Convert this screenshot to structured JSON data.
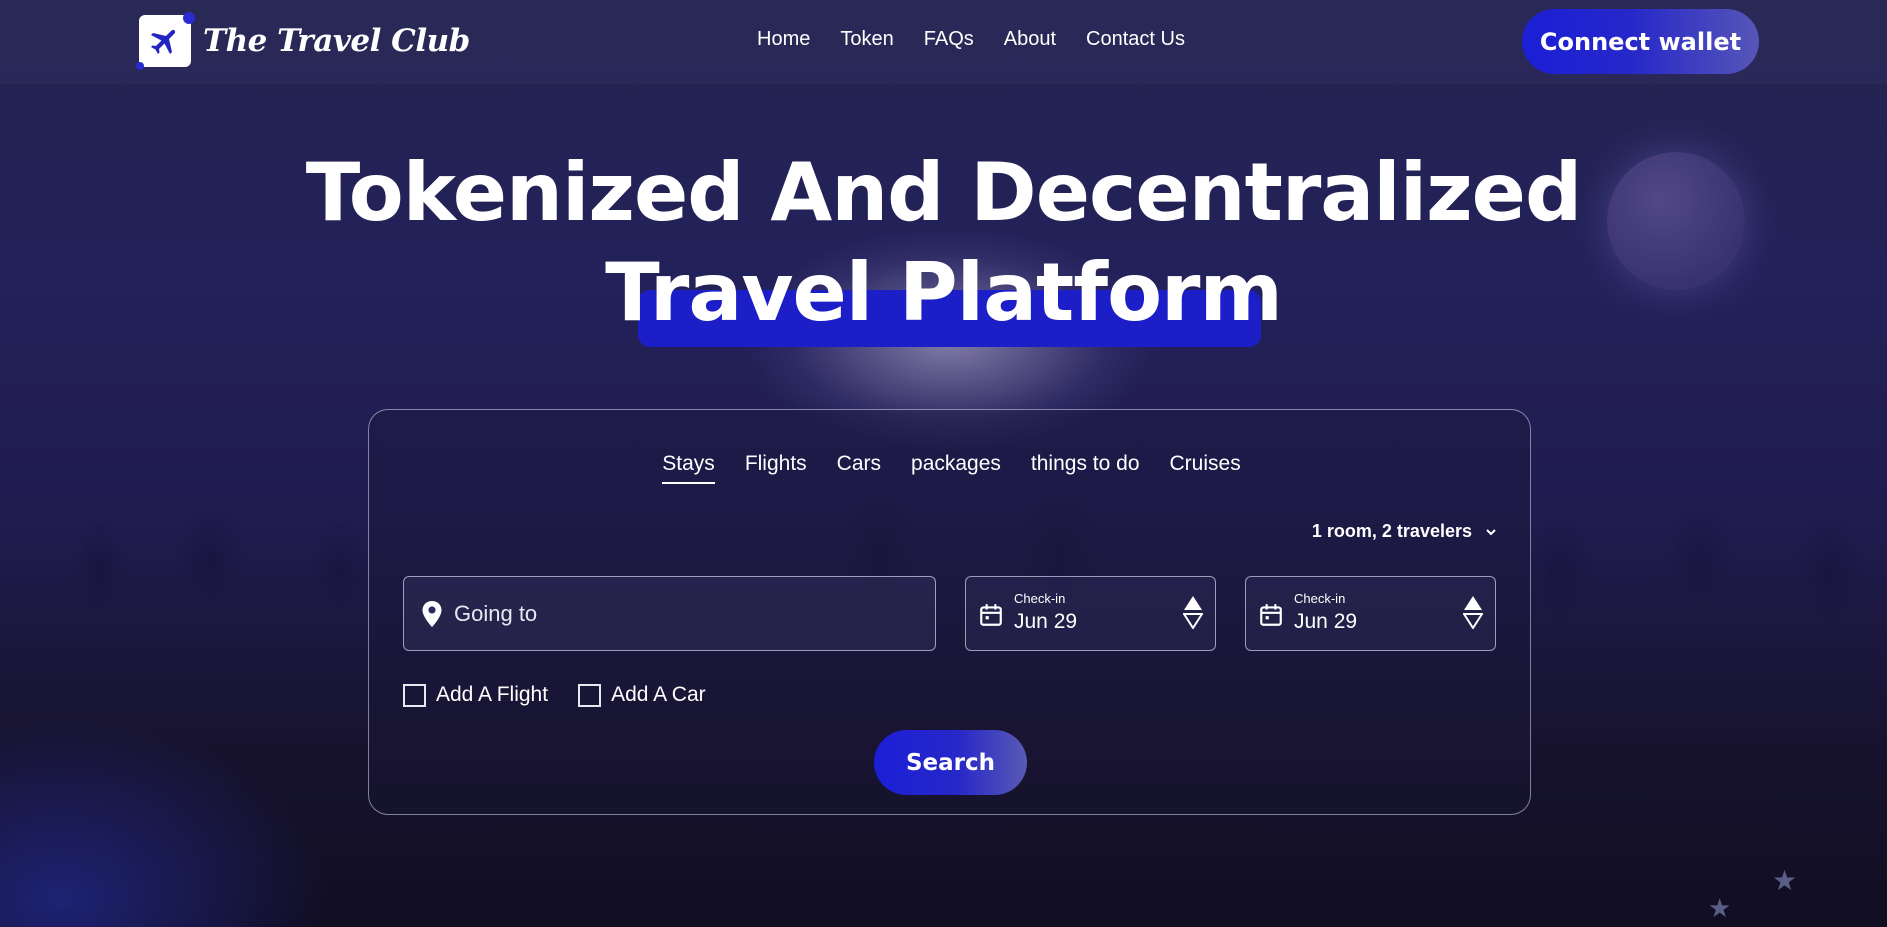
{
  "brand": {
    "name": "The Travel Club",
    "logo_icon": "airplane-icon",
    "accent_color": "#1c1fc7"
  },
  "nav": {
    "links": [
      "Home",
      "Token",
      "FAQs",
      "About",
      "Contact Us"
    ],
    "connect_label": "Connect wallet"
  },
  "hero": {
    "line1": "Tokenized And Decentralized",
    "line2": "Travel Platform"
  },
  "search": {
    "tabs": [
      "Stays",
      "Flights",
      "Cars",
      "packages",
      "things to do",
      "Cruises"
    ],
    "active_tab": "Stays",
    "travelers_label": "1 room, 2 travelers",
    "going_placeholder": "Going to",
    "checkin1": {
      "label": "Check-in",
      "value": "Jun 29"
    },
    "checkin2": {
      "label": "Check-in",
      "value": "Jun 29"
    },
    "add_flight_label": "Add A Flight",
    "add_car_label": "Add A Car",
    "search_label": "Search"
  }
}
